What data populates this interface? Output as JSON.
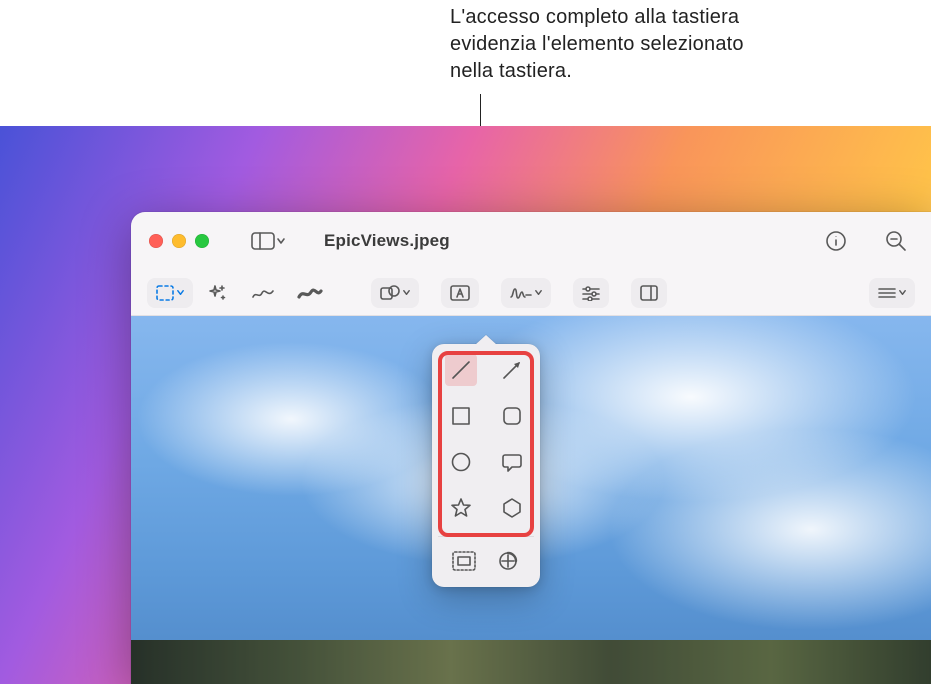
{
  "caption": "L'accesso completo alla tastiera evidenzia l'elemento selezionato nella tastiera.",
  "window": {
    "title": "EpicViews.jpeg"
  },
  "toolbar": {
    "sidebar": "sidebar",
    "info": "info",
    "zoom_out": "zoom-out"
  },
  "markup": {
    "select": "select",
    "instant_alpha": "instant-alpha",
    "sketch": "sketch",
    "draw": "draw",
    "shapes": "shapes",
    "text": "text",
    "sign": "sign",
    "adjust": "adjust-color",
    "crop": "crop",
    "border": "border"
  },
  "shapes_popover": {
    "items": [
      {
        "name": "line",
        "selected": true
      },
      {
        "name": "arrow",
        "selected": false
      },
      {
        "name": "square",
        "selected": false
      },
      {
        "name": "rounded-square",
        "selected": false
      },
      {
        "name": "circle",
        "selected": false
      },
      {
        "name": "speech-bubble",
        "selected": false
      },
      {
        "name": "star",
        "selected": false
      },
      {
        "name": "hexagon",
        "selected": false
      }
    ],
    "bottom": [
      {
        "name": "loupe"
      },
      {
        "name": "mask"
      }
    ]
  }
}
